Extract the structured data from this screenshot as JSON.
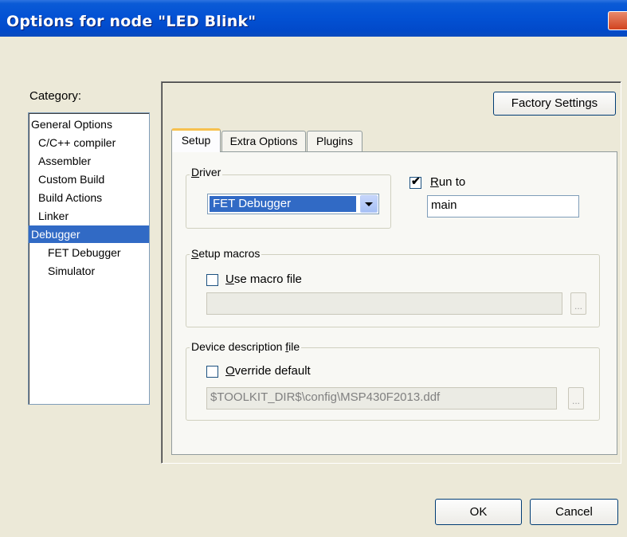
{
  "window": {
    "title": "Options for node \"LED Blink\""
  },
  "category": {
    "label": "Category:",
    "items": [
      "General Options",
      "C/C++ compiler",
      "Assembler",
      "Custom Build",
      "Build Actions",
      "Linker",
      "Debugger",
      "FET Debugger",
      "Simulator"
    ],
    "selected": "Debugger"
  },
  "factory_settings_label": "Factory Settings",
  "tabs": [
    "Setup",
    "Extra Options",
    "Plugins"
  ],
  "active_tab": "Setup",
  "driver": {
    "group_label_rest": "river",
    "group_label_mnemonic": "D",
    "value": "FET Debugger"
  },
  "run_to": {
    "checked": true,
    "label_mnemonic": "R",
    "label_rest": "un to",
    "value": "main"
  },
  "setup_macros": {
    "group_label_mnemonic": "S",
    "group_label_rest": "etup macros",
    "use_macro_mnemonic": "U",
    "use_macro_rest": "se macro file",
    "checked": false,
    "path": "",
    "browse_label": "..."
  },
  "device_description": {
    "group_label_prefix": "Device description ",
    "group_label_mnemonic": "f",
    "group_label_rest": "ile",
    "override_mnemonic": "O",
    "override_rest": "verride default",
    "checked": false,
    "path": "$TOOLKIT_DIR$\\config\\MSP430F2013.ddf",
    "browse_label": "..."
  },
  "ok_label": "OK",
  "cancel_label": "Cancel"
}
